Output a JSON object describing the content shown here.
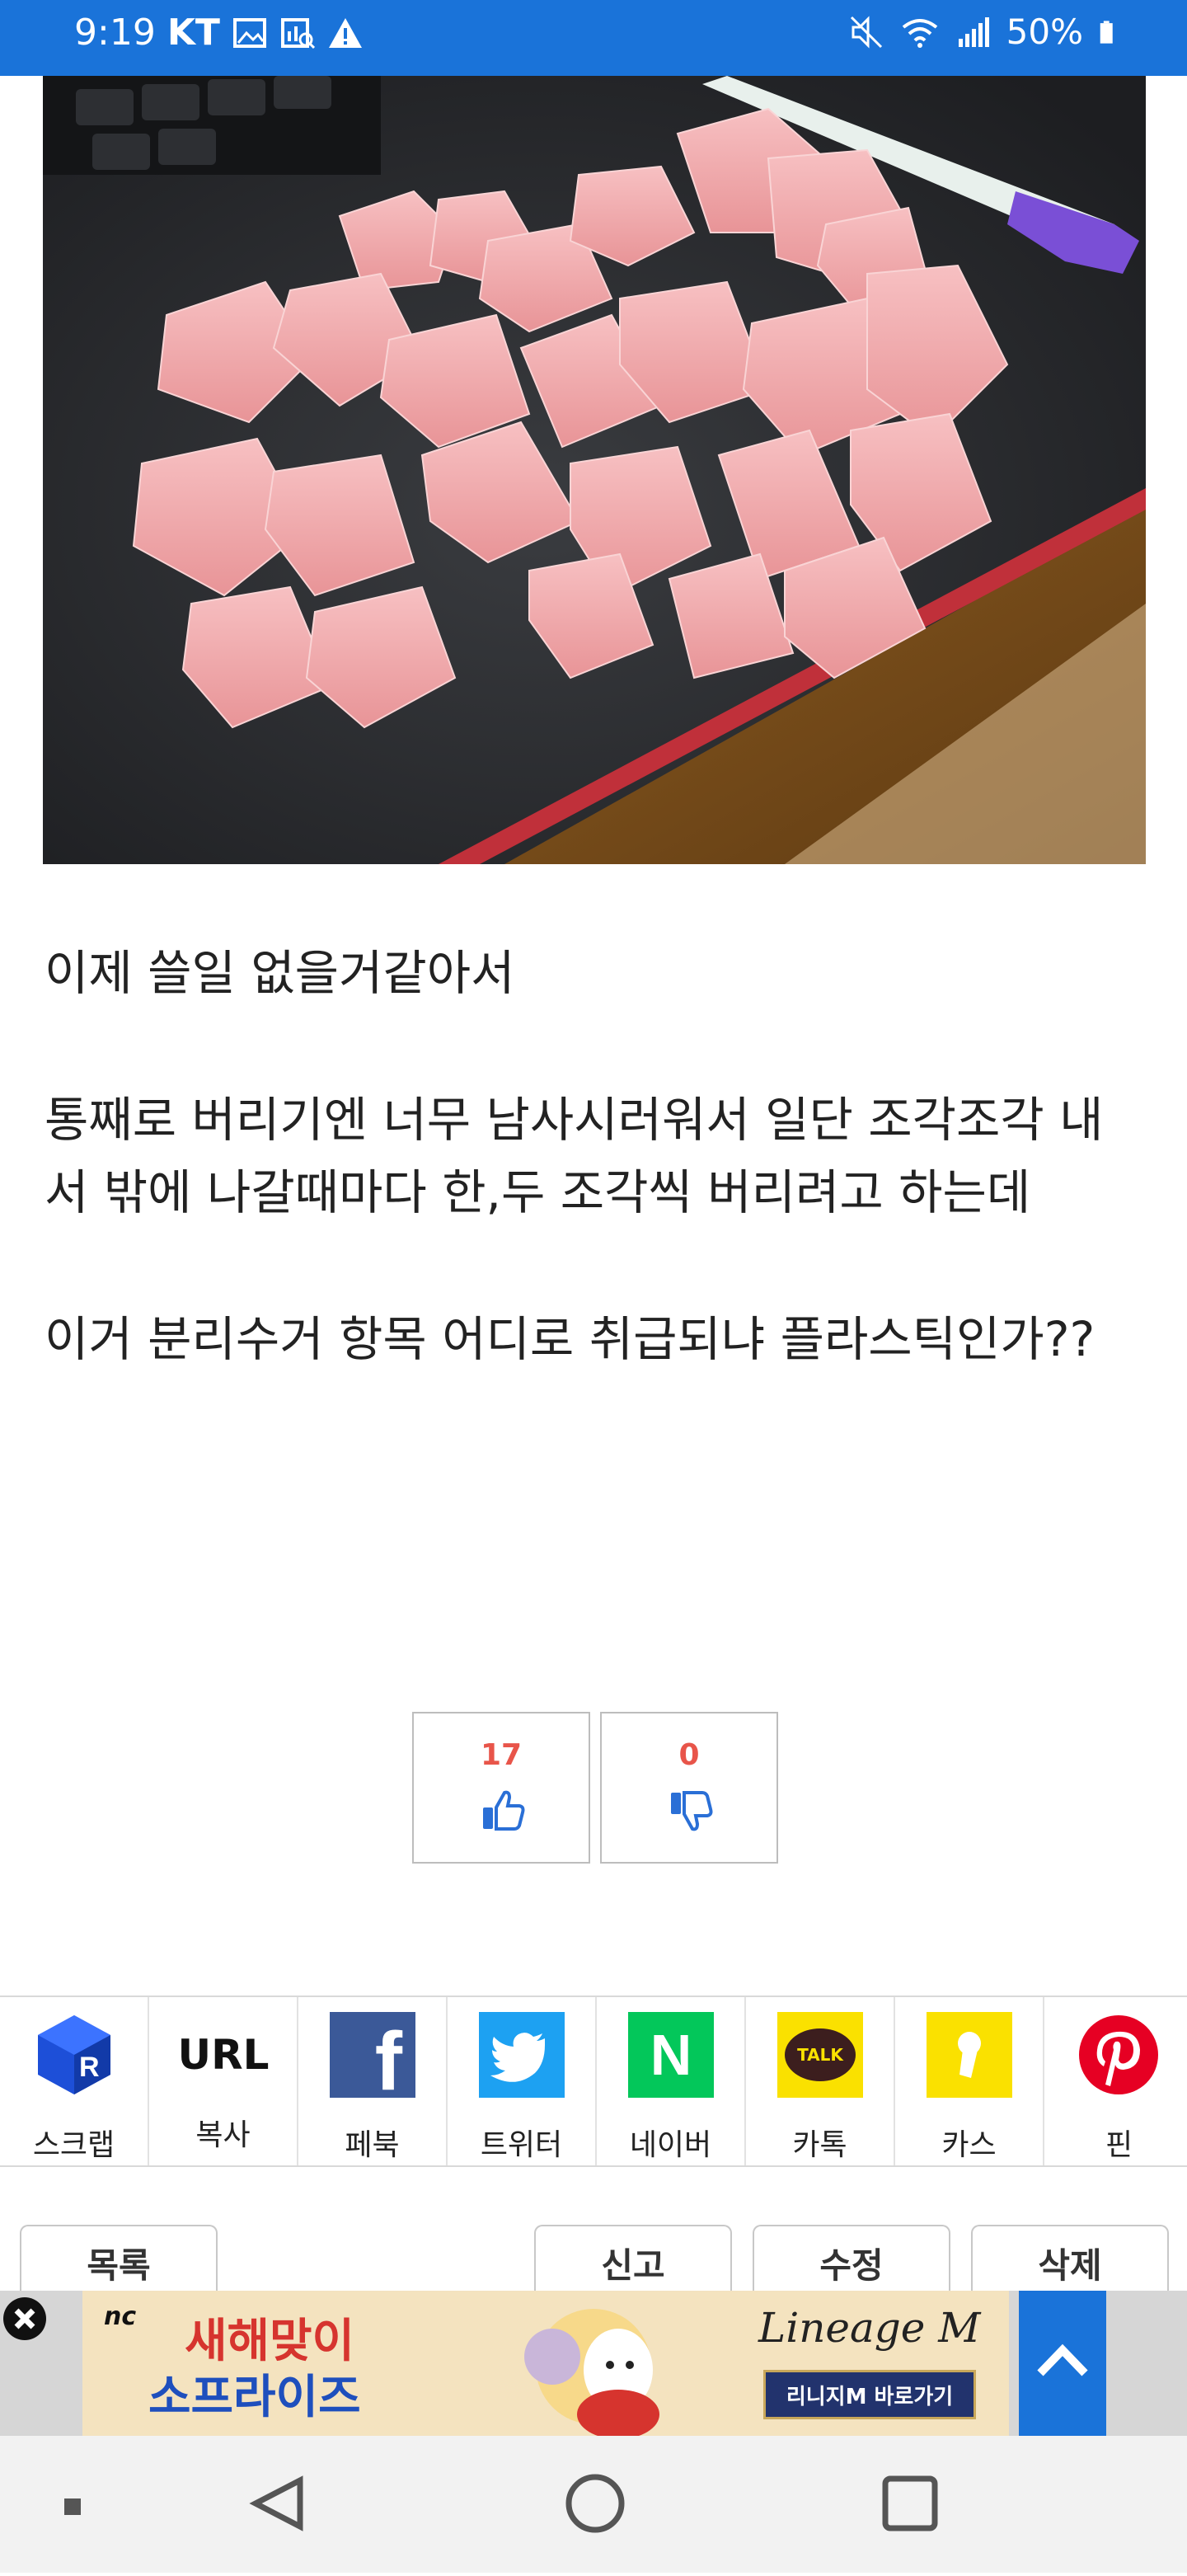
{
  "status_bar": {
    "time": "9:19",
    "carrier": "KT",
    "battery": "50%",
    "icons": [
      "gallery-icon",
      "report-icon",
      "warning-icon",
      "mute-icon",
      "wifi-icon",
      "signal-icon",
      "battery-icon"
    ]
  },
  "post": {
    "lines": [
      "이제 쓸일 없을거같아서",
      "통째로 버리기엔 너무 남사시러워서 일단 조각조각 내",
      "서 밖에 나갈때마다 한,두 조각씩 버리려고 하는데",
      "이거 분리수거 항목 어디로 취급되냐 플라스틱인가??"
    ]
  },
  "votes": {
    "up_count": "17",
    "down_count": "0"
  },
  "share": {
    "items": [
      {
        "label": "스크랩",
        "icon": "scrap-icon"
      },
      {
        "label": "복사",
        "icon": "url-icon",
        "icon_text": "URL"
      },
      {
        "label": "페북",
        "icon": "facebook-icon",
        "icon_text": "f"
      },
      {
        "label": "트위터",
        "icon": "twitter-icon"
      },
      {
        "label": "네이버",
        "icon": "naver-icon",
        "icon_text": "N"
      },
      {
        "label": "카톡",
        "icon": "kakaotalk-icon",
        "icon_text": "TALK"
      },
      {
        "label": "카스",
        "icon": "kakaostory-icon"
      },
      {
        "label": "핀",
        "icon": "pinterest-icon"
      }
    ]
  },
  "actions": {
    "list": "목록",
    "report": "신고",
    "edit": "수정",
    "delete": "삭제"
  },
  "ad": {
    "brand": "nc",
    "headline_1": "새해맞이",
    "headline_2": "소프라이즈",
    "logo": "Lineage M",
    "cta": "리니지M 바로가기"
  },
  "colors": {
    "status_bar": "#1a73d9",
    "vote_count": "#e8554a",
    "facebook": "#3b5998",
    "twitter": "#1da1f2",
    "naver": "#03c75a",
    "kakao": "#fae100",
    "pinterest": "#e60023"
  }
}
